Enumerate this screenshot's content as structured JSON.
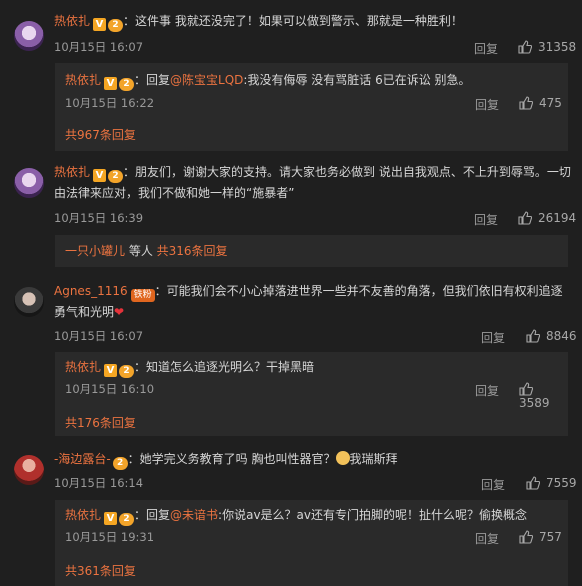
{
  "comments": [
    {
      "user": "热依扎",
      "text": "：这件事 我就还没完了！如果可以做到警示、那就是一种胜利！",
      "time": "10月15日 16:07",
      "reply": "回复",
      "likes": "31358",
      "sub": {
        "user": "热依扎",
        "prefix": "：回复",
        "mention": "@陈宝宝LQD",
        "text": ":我没有侮辱 没有骂脏话 6已在诉讼 别急。",
        "time": "10月15日 16:22",
        "reply": "回复",
        "likes": "475"
      },
      "more": "共967条回复"
    },
    {
      "user": "热依扎",
      "text": "：朋友们，谢谢大家的支持。请大家也务必做到 说出自我观点、不上升到辱骂。一切由法律来应对，我们不做和她一样的“施暴者”",
      "time": "10月15日 16:39",
      "reply": "回复",
      "likes": "26194",
      "more_user": "一只小罐儿",
      "more_mid": " 等人 ",
      "more": "共316条回复"
    },
    {
      "user": "Agnes_1116",
      "fan_badge": "铁粉",
      "text": "：可能我们会不小心掉落进世界一些并不友善的角落，但我们依旧有权利追逐勇气和光明",
      "time": "10月15日 16:07",
      "reply": "回复",
      "likes": "8846",
      "sub": {
        "user": "热依扎",
        "text": "：知道怎么追逐光明么？干掉黑暗",
        "time": "10月15日 16:10",
        "reply": "回复",
        "likes": "3589"
      },
      "more": "共176条回复"
    },
    {
      "user": "-海边露台-",
      "text": "：她学完义务教育了吗 胸也叫性器官？",
      "text2": "我瑞斯拜",
      "time": "10月15日 16:14",
      "reply": "回复",
      "likes": "7559",
      "sub": {
        "user": "热依扎",
        "prefix": "：回复",
        "mention": "@未谙书",
        "text": ":你说av是么？av还有专门拍脚的呢！扯什么呢？偷换概念",
        "time": "10月15日 19:31",
        "reply": "回复",
        "likes": "757"
      },
      "more": "共361条回复"
    }
  ],
  "icons": {
    "verified": "V",
    "medal": "2",
    "like": "thumbs-up-icon"
  },
  "colors": {
    "accent": "#eb7340",
    "bg": "#1f1f1f",
    "subbg": "#2a2a2a"
  }
}
